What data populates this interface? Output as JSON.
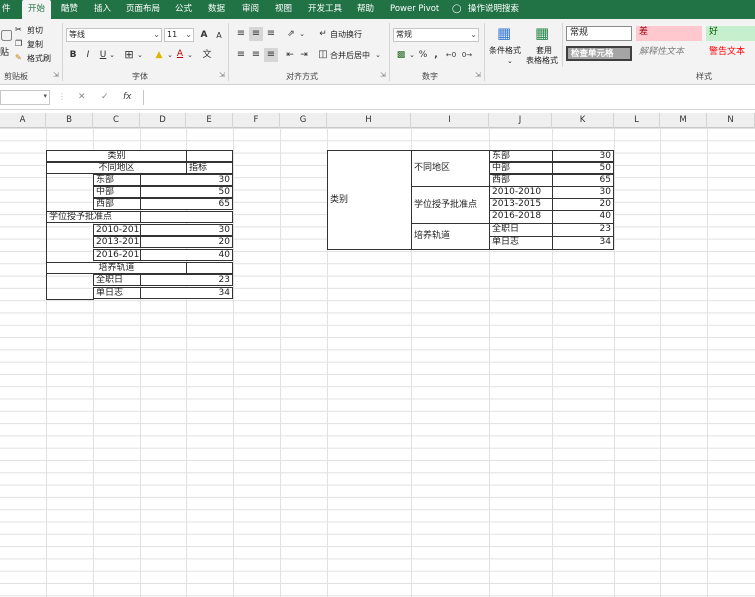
{
  "tabs": [
    "件",
    "开始",
    "酷赞",
    "插入",
    "页面布局",
    "公式",
    "数据",
    "审阅",
    "视图",
    "开发工具",
    "帮助",
    "Power Pivot",
    "操作说明搜索"
  ],
  "ribbon": {
    "clipboard": {
      "paste": "贴",
      "cut": "剪切",
      "copy": "复制",
      "format_painter": "格式刷",
      "label": "剪贴板"
    },
    "font": {
      "name": "等线",
      "size": "11",
      "label": "字体",
      "bold": "B",
      "italic": "I",
      "underline": "U",
      "grow": "A",
      "shrink": "A",
      "wen": "文",
      "font_color": "A"
    },
    "alignment": {
      "wrap": "自动换行",
      "merge": "合并后居中",
      "label": "对齐方式"
    },
    "number": {
      "format": "常规",
      "percent": "%",
      "comma": ",",
      "label": "数字"
    },
    "cond_format": "条件格式",
    "table_format_1": "套用",
    "table_format_2": "表格格式",
    "styles": {
      "normal": "常规",
      "bad": "差",
      "good": "好",
      "check_cell": "检查单元格",
      "explanatory": "解释性文本",
      "warning": "警告文本",
      "label": "样式"
    }
  },
  "formula_bar": {
    "name_box": "",
    "cancel": "✕",
    "enter": "✓",
    "fx": "fx",
    "value": ""
  },
  "columns": [
    "A",
    "B",
    "C",
    "D",
    "E",
    "F",
    "G",
    "H",
    "I",
    "J",
    "K",
    "L",
    "M",
    "N"
  ],
  "table1": {
    "category": "类别",
    "region": "不同地区",
    "indicator": "指标",
    "east": "东部",
    "east_v": "30",
    "central": "中部",
    "central_v": "50",
    "west": "西部",
    "west_v": "65",
    "degree": "学位授予批准点",
    "y1": "2010-2010",
    "y1_v": "30",
    "y2": "2013-2015",
    "y2_v": "20",
    "y3": "2016-2018",
    "y3_v": "40",
    "training": "培养轨道",
    "fulltime": "全职日",
    "fulltime_v": "23",
    "single": "单日志",
    "single_v": "34"
  },
  "table2": {
    "category": "类别",
    "region": "不同地区",
    "degree": "学位授予批准点",
    "training": "培养轨道",
    "east": "东部",
    "east_v": "30",
    "central": "中部",
    "central_v": "50",
    "west": "西部",
    "west_v": "65",
    "y1": "2010-2010",
    "y1_v": "30",
    "y2": "2013-2015",
    "y2_v": "20",
    "y3": "2016-2018",
    "y3_v": "40",
    "fulltime": "全职日",
    "fulltime_v": "23",
    "single": "单日志",
    "single_v": "34"
  },
  "colors": {
    "accent": "#217346",
    "bad_bg": "#ffc7ce",
    "bad_fg": "#9c0006",
    "good_bg": "#c6efce",
    "good_fg": "#006100",
    "warning_fg": "#ff0000",
    "check_bg": "#a5a5a5"
  }
}
